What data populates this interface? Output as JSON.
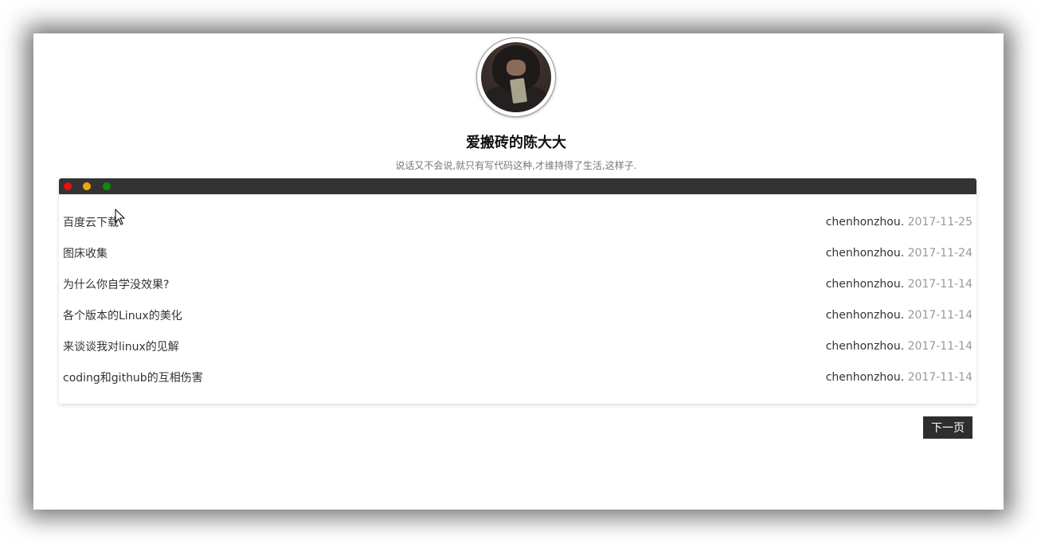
{
  "profile": {
    "name": "爱搬砖的陈大大",
    "motto": "说话又不会说,就只有写代码这种,才维持得了生活,这样子."
  },
  "window_controls": {
    "colors": [
      "#e81010",
      "#f2a60c",
      "#0e8a0e"
    ]
  },
  "posts": [
    {
      "title": "百度云下载",
      "author": "chenhonzhou.",
      "date": "2017-11-25"
    },
    {
      "title": "图床收集",
      "author": "chenhonzhou.",
      "date": "2017-11-24"
    },
    {
      "title": "为什么你自学没效果?",
      "author": "chenhonzhou.",
      "date": "2017-11-14"
    },
    {
      "title": "各个版本的Linux的美化",
      "author": "chenhonzhou.",
      "date": "2017-11-14"
    },
    {
      "title": "来谈谈我对linux的见解",
      "author": "chenhonzhou.",
      "date": "2017-11-14"
    },
    {
      "title": "coding和github的互相伤害",
      "author": "chenhonzhou.",
      "date": "2017-11-14"
    }
  ],
  "pagination": {
    "next_label": "下一页"
  }
}
